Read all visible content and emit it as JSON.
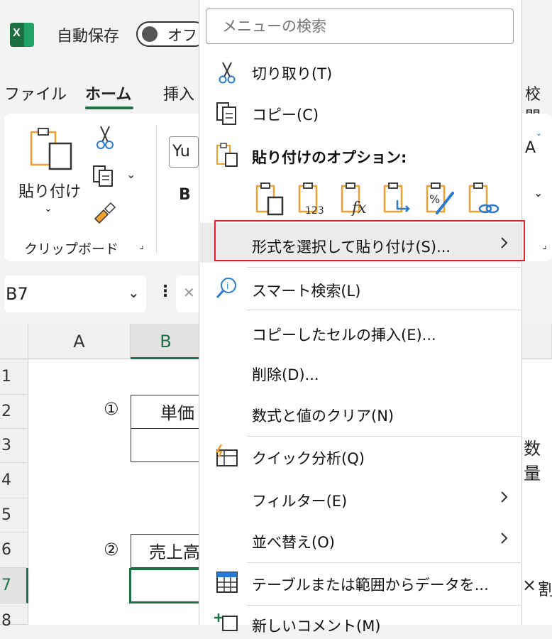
{
  "titlebar": {
    "autosave_label": "自動保存",
    "autosave_state": "オフ"
  },
  "tabs": [
    "ファイル",
    "ホーム",
    "挿入",
    "校閲"
  ],
  "ribbon": {
    "paste_label": "貼り付け",
    "clipboard_group": "クリップボード",
    "font_name": "Yu",
    "bold": "B",
    "font_grow": "A"
  },
  "namebox": {
    "value": "B7"
  },
  "sheet": {
    "columns": [
      "A",
      "B"
    ],
    "rows": [
      "1",
      "2",
      "3",
      "4",
      "5",
      "6",
      "7",
      "8"
    ],
    "marker1": "①",
    "header1": "単価",
    "marker2": "②",
    "header2": "売上高",
    "right_text1": "数量",
    "right_text2": "×",
    "right_text2b": "割"
  },
  "menu": {
    "search_placeholder": "メニューの検索",
    "items": {
      "cut": "切り取り(T)",
      "copy": "コピー(C)",
      "paste_options": "貼り付けのオプション:",
      "paste_special": "形式を選択して貼り付け(S)...",
      "smart_lookup": "スマート検索(L)",
      "insert_copied": "コピーしたセルの挿入(E)...",
      "delete": "削除(D)...",
      "clear": "数式と値のクリア(N)",
      "quick_analysis": "クイック分析(Q)",
      "filter": "フィルター(E)",
      "sort": "並べ替え(O)",
      "table_range": "テーブルまたは範囲からデータを...",
      "new_comment": "新しいコメント(M)"
    }
  },
  "colors": {
    "excel_green": "#1e7145",
    "highlight_red": "#e0202a",
    "icon_orange": "#f0a030",
    "icon_blue": "#2a7bd0"
  }
}
